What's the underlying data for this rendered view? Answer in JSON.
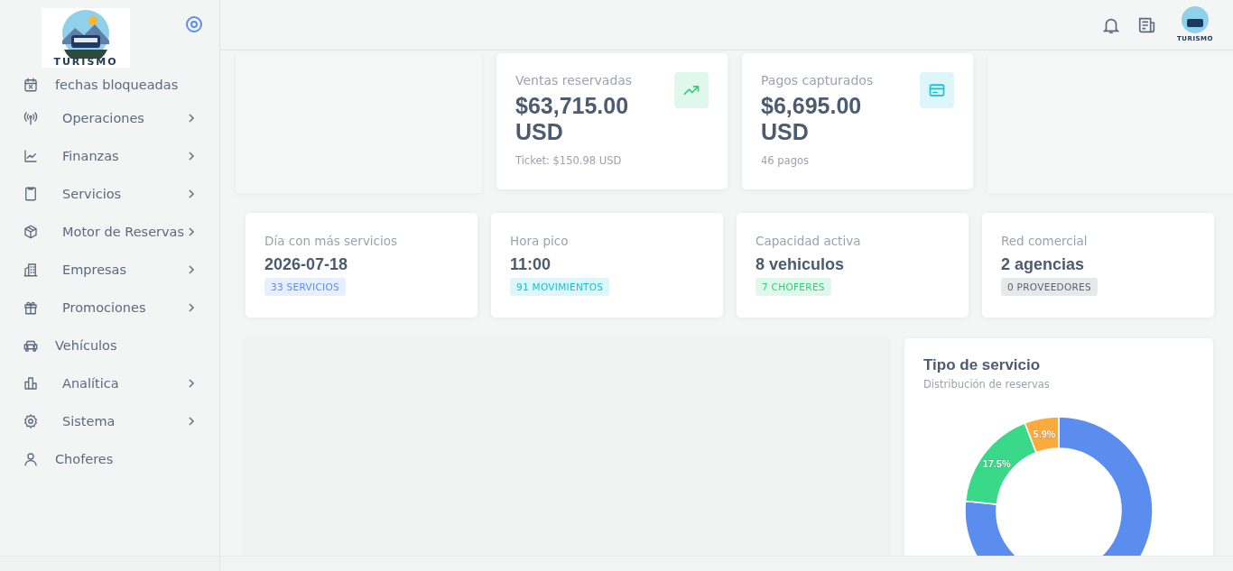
{
  "sidebar": {
    "logo_text": "TURISMO",
    "items": [
      {
        "label": "fechas bloqueadas",
        "kind": "link"
      },
      {
        "label": "Operaciones",
        "kind": "group"
      },
      {
        "label": "Finanzas",
        "kind": "group"
      },
      {
        "label": "Servicios",
        "kind": "group"
      },
      {
        "label": "Motor de Reservas",
        "kind": "group"
      },
      {
        "label": "Empresas",
        "kind": "group"
      },
      {
        "label": "Promociones",
        "kind": "group"
      },
      {
        "label": "Vehículos",
        "kind": "link"
      },
      {
        "label": "Analítica",
        "kind": "group"
      },
      {
        "label": "Sistema",
        "kind": "group"
      },
      {
        "label": "Choferes",
        "kind": "link"
      }
    ]
  },
  "topbar": {
    "avatar_text": "TURISMO"
  },
  "stats": [
    {
      "title": "Ventas reservadas",
      "value": "$63,715.00 USD",
      "note": "Ticket: $150.98 USD",
      "color": "#2fcf7a"
    },
    {
      "title": "Pagos capturados",
      "value": "$6,695.00 USD",
      "note": "46 pagos",
      "color": "#17c1d8"
    }
  ],
  "kpis": [
    {
      "title": "Día con más servicios",
      "value": "2026-07-18",
      "badge": "33 SERVICIOS",
      "color": "#5b8def"
    },
    {
      "title": "Hora pico",
      "value": "11:00",
      "badge": "91 MOVIMIENTOS",
      "color": "#17c1d8"
    },
    {
      "title": "Capacidad activa",
      "value": "8 vehiculos",
      "badge": "7 CHOFERES",
      "color": "#2fcf7a"
    },
    {
      "title": "Red comercial",
      "value": "2 agencias",
      "badge": "0 PROVEEDORES",
      "color": "#5b6470"
    }
  ],
  "service_chart": {
    "title": "Tipo de servicio",
    "subtitle": "Distribución de reservas",
    "chart_data": {
      "type": "donut",
      "values": [
        76.6,
        17.5,
        5.9
      ],
      "colors": [
        "#5b8def",
        "#3ad98a",
        "#fbab3c"
      ],
      "value_labels": [
        null,
        "17.5%",
        "5.9%"
      ]
    }
  }
}
